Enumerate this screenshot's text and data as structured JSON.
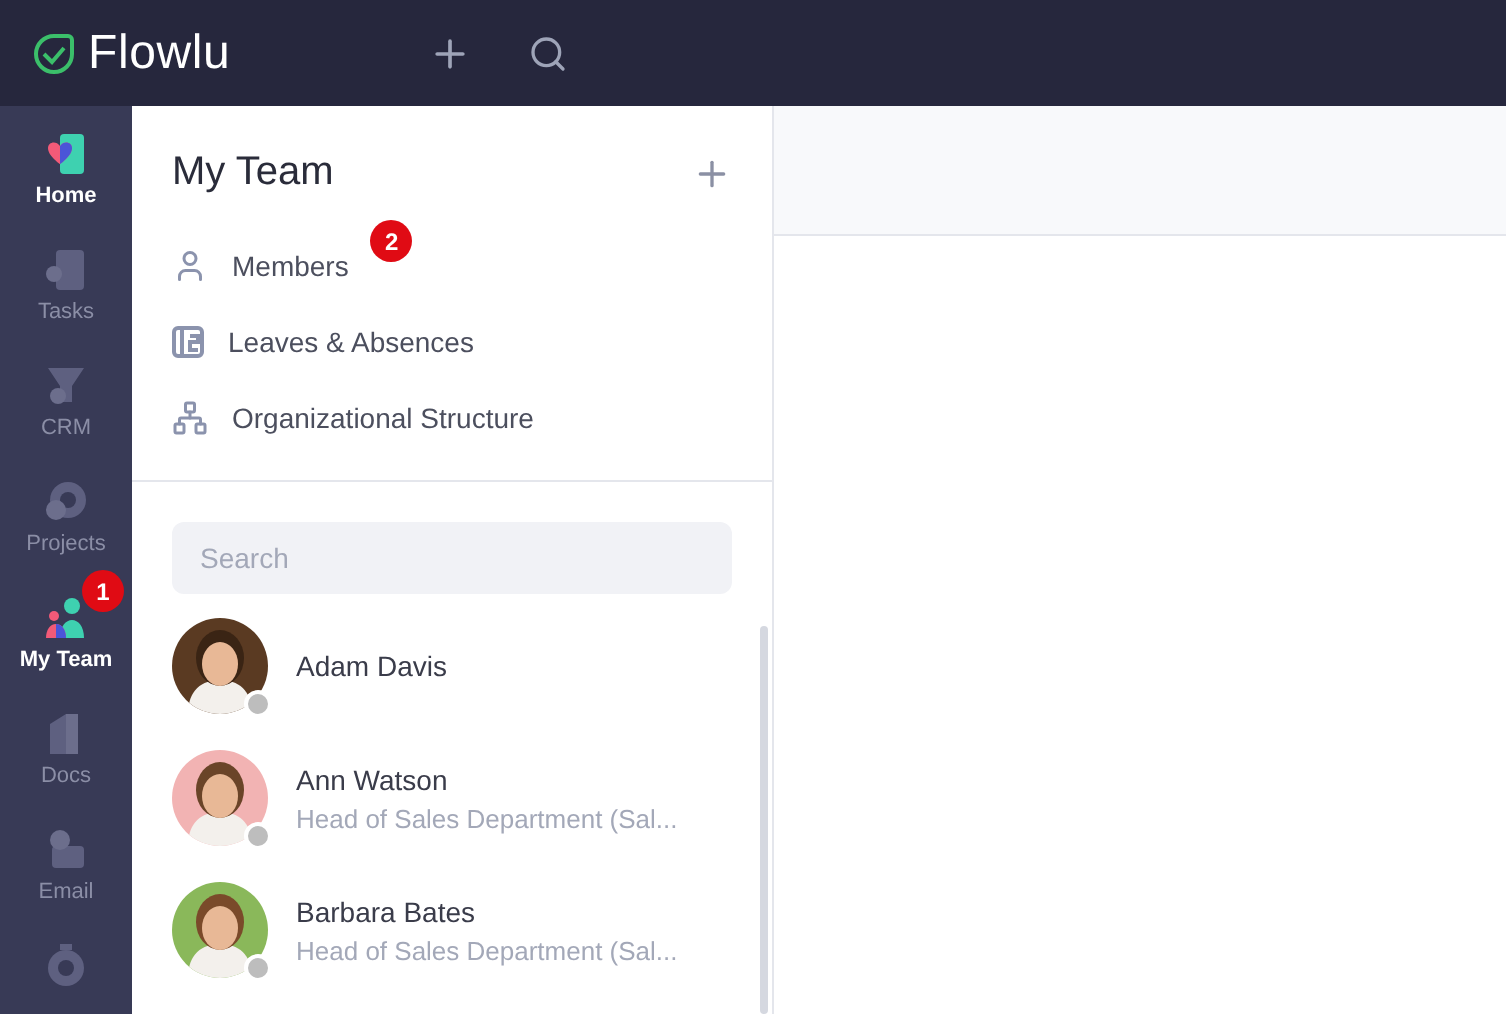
{
  "topbar": {
    "logo": "Flowlu"
  },
  "nav": [
    {
      "label": "Home",
      "active": true,
      "kind": "home"
    },
    {
      "label": "Tasks",
      "active": false,
      "kind": "tasks"
    },
    {
      "label": "CRM",
      "active": false,
      "kind": "crm"
    },
    {
      "label": "Projects",
      "active": false,
      "kind": "projects"
    },
    {
      "label": "My Team",
      "active": true,
      "kind": "team",
      "badge": "1"
    },
    {
      "label": "Docs",
      "active": false,
      "kind": "docs"
    },
    {
      "label": "Email",
      "active": false,
      "kind": "email"
    },
    {
      "kind": "timer"
    }
  ],
  "panel": {
    "title": "My Team",
    "menu": [
      {
        "label": "Members",
        "kind": "members",
        "badge": "2"
      },
      {
        "label": "Leaves & Absences",
        "kind": "leaves"
      },
      {
        "label": "Organizational Structure",
        "kind": "org"
      }
    ],
    "search": {
      "placeholder": "Search"
    },
    "people": [
      {
        "name": "Adam Davis"
      },
      {
        "name": "Ann Watson",
        "role": "Head of Sales Department (Sal..."
      },
      {
        "name": "Barbara Bates",
        "role": "Head of Sales Department (Sal..."
      }
    ]
  }
}
